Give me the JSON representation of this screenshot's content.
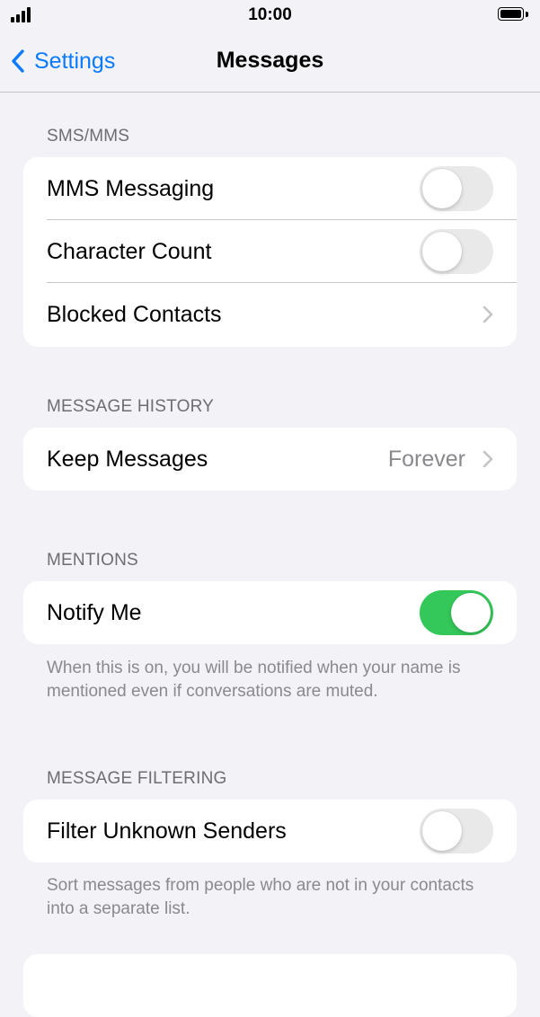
{
  "status_bar": {
    "time": "10:00",
    "signal_bars": 4,
    "battery_level": 1.0
  },
  "nav": {
    "back_label": "Settings",
    "title": "Messages"
  },
  "sections": {
    "sms_mms": {
      "header": "SMS/MMS",
      "mms_messaging": {
        "label": "MMS Messaging",
        "on": false
      },
      "character_count": {
        "label": "Character Count",
        "on": false
      },
      "blocked_contacts": {
        "label": "Blocked Contacts"
      }
    },
    "message_history": {
      "header": "MESSAGE HISTORY",
      "keep_messages": {
        "label": "Keep Messages",
        "value": "Forever"
      }
    },
    "mentions": {
      "header": "MENTIONS",
      "notify_me": {
        "label": "Notify Me",
        "on": true
      },
      "footer": "When this is on, you will be notified when your name is mentioned even if conversations are muted."
    },
    "message_filtering": {
      "header": "MESSAGE FILTERING",
      "filter_unknown_senders": {
        "label": "Filter Unknown Senders",
        "on": false
      },
      "footer": "Sort messages from people who are not in your contacts into a separate list."
    }
  },
  "colors": {
    "accent": "#0a7aff",
    "toggle_on": "#34c759",
    "toggle_off": "#e9e9ea",
    "background": "#f2f2f7"
  },
  "icons": {
    "back": "chevron-left-icon",
    "disclosure": "chevron-right-icon",
    "signal": "cellular-signal-icon",
    "battery": "battery-icon"
  }
}
